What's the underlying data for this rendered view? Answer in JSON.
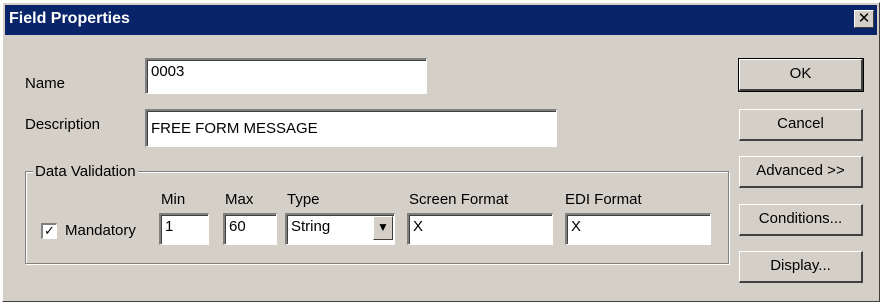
{
  "window": {
    "title": "Field Properties",
    "close_glyph": "✕"
  },
  "form": {
    "name_label": "Name",
    "name_value": "0003",
    "description_label": "Description",
    "description_value": "FREE FORM MESSAGE"
  },
  "validation": {
    "group_title": "Data Validation",
    "mandatory_label": "Mandatory",
    "mandatory_checked": true,
    "min_label": "Min",
    "min_value": "1",
    "max_label": "Max",
    "max_value": "60",
    "type_label": "Type",
    "type_value": "String",
    "screen_format_label": "Screen Format",
    "screen_format_value": "X",
    "edi_format_label": "EDI Format",
    "edi_format_value": "X"
  },
  "buttons": {
    "ok": "OK",
    "cancel": "Cancel",
    "advanced": "Advanced >>",
    "conditions": "Conditions...",
    "display": "Display..."
  },
  "icons": {
    "checkmark": "✓",
    "dropdown_arrow": "▼"
  }
}
